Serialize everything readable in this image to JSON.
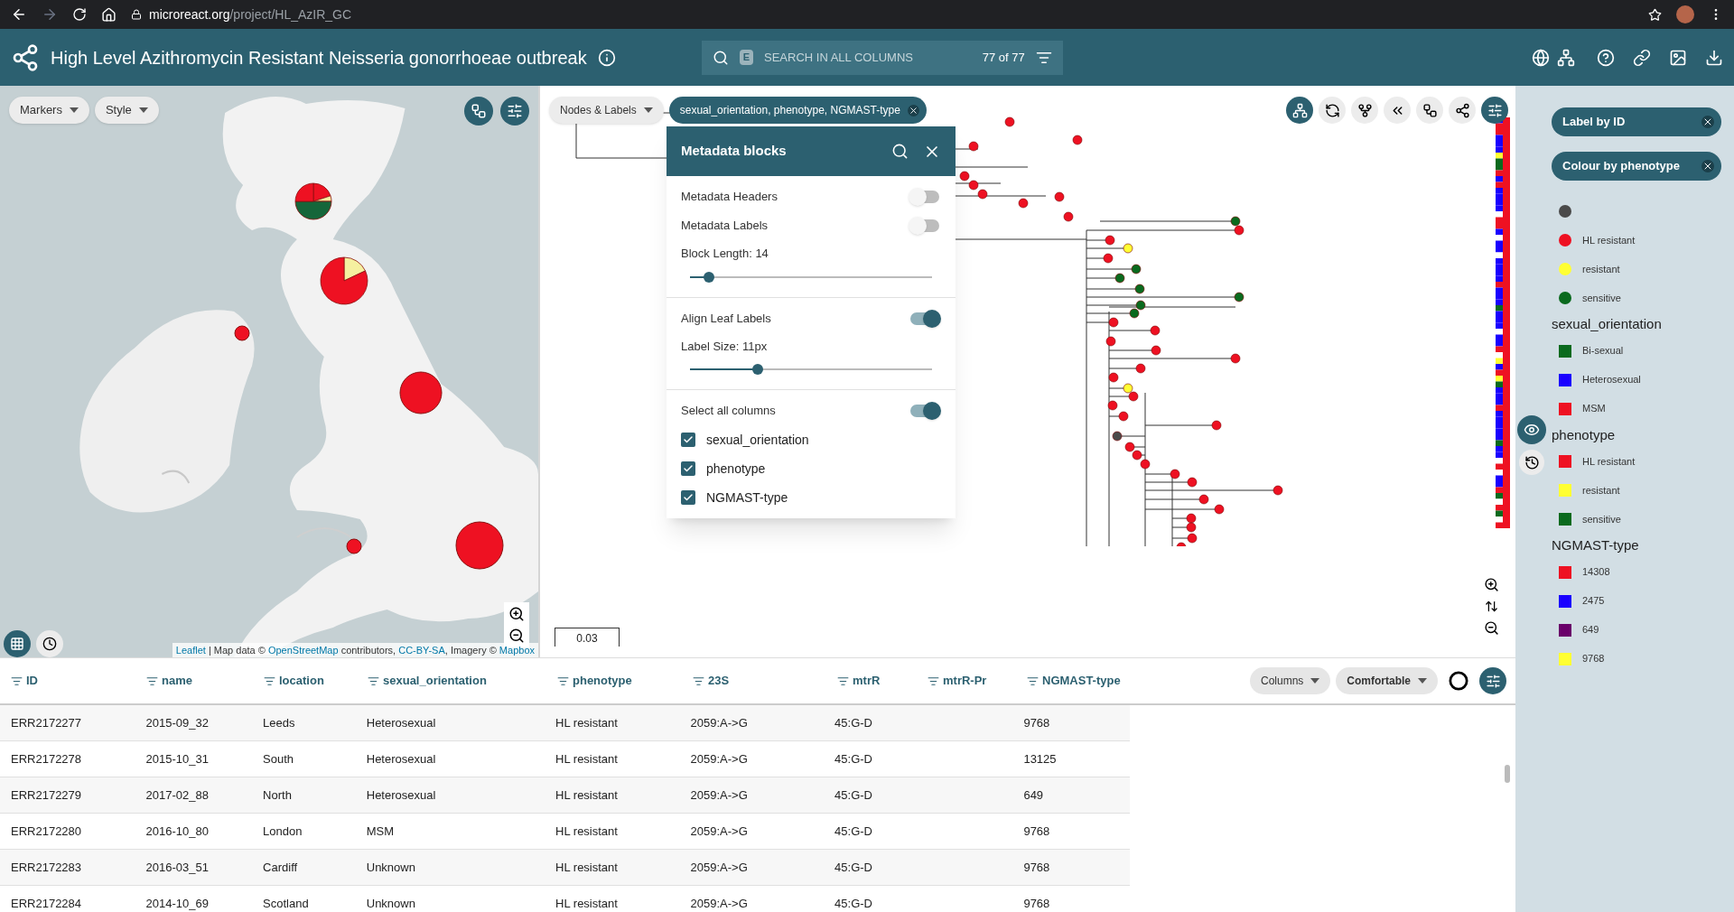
{
  "browser": {
    "host": "microreact.org",
    "path": "/project/HL_AzIR_GC"
  },
  "header": {
    "title": "High Level Azithromycin Resistant Neisseria gonorrhoeae outbreak",
    "search_key": "E",
    "search_placeholder": "SEARCH IN ALL COLUMNS",
    "count": "77 of 77"
  },
  "map": {
    "buttons": [
      "Markers",
      "Style"
    ],
    "attribution": [
      {
        "text": "Leaflet",
        "kind": "link"
      },
      {
        "text": " | Map data © ",
        "kind": "text"
      },
      {
        "text": "OpenStreetMap",
        "kind": "link"
      },
      {
        "text": " contributors, ",
        "kind": "text"
      },
      {
        "text": "CC-BY-SA",
        "kind": "link"
      },
      {
        "text": ", Imagery © ",
        "kind": "text"
      },
      {
        "text": "Mapbox",
        "kind": "link"
      }
    ]
  },
  "tree": {
    "menu": "Nodes & Labels",
    "chip": "sexual_orientation, phenotype, NGMAST-type",
    "scale": "0.03"
  },
  "metadata_panel": {
    "title": "Metadata blocks",
    "sections": [
      {
        "items": [
          {
            "kind": "toggle",
            "label": "Metadata Headers",
            "on": false
          },
          {
            "kind": "toggle",
            "label": "Metadata Labels",
            "on": false
          },
          {
            "kind": "slider",
            "label": "Block Length: 14",
            "level": 0.08
          }
        ]
      },
      {
        "items": [
          {
            "kind": "toggle",
            "label": "Align Leaf Labels",
            "on": true
          },
          {
            "kind": "slider",
            "label": "Label Size: 11px",
            "level": 0.28
          }
        ]
      },
      {
        "items": [
          {
            "kind": "toggle",
            "label": "Select all columns",
            "on": true
          },
          {
            "kind": "checkbox",
            "label": "sexual_orientation",
            "checked": true
          },
          {
            "kind": "checkbox",
            "label": "phenotype",
            "checked": true
          },
          {
            "kind": "checkbox",
            "label": "NGMAST-type",
            "checked": true
          }
        ]
      }
    ]
  },
  "legend": {
    "chips": [
      "Label by ID",
      "Colour by phenotype"
    ],
    "groups": [
      {
        "kind": "circle",
        "items": [
          {
            "color": "#4a4a4a"
          },
          {
            "label": "HL resistant",
            "color": "#ee1122"
          },
          {
            "label": "resistant",
            "color": "#ffff33"
          },
          {
            "label": "sensitive",
            "color": "#0a6a1e"
          }
        ]
      },
      {
        "title": "sexual_orientation",
        "kind": "square",
        "items": [
          {
            "label": "Bi-sexual",
            "color": "#0a6a1e"
          },
          {
            "label": "Heterosexual",
            "color": "#1a00ff"
          },
          {
            "label": "MSM",
            "color": "#ee1122"
          }
        ]
      },
      {
        "title": "phenotype",
        "kind": "square",
        "items": [
          {
            "label": "HL resistant",
            "color": "#ee1122"
          },
          {
            "label": "resistant",
            "color": "#ffff33"
          },
          {
            "label": "sensitive",
            "color": "#0a6a1e"
          }
        ]
      },
      {
        "title": "NGMAST-type",
        "kind": "square",
        "items": [
          {
            "label": "14308",
            "color": "#ee1122"
          },
          {
            "label": "2475",
            "color": "#1a00ff"
          },
          {
            "label": "649",
            "color": "#6a006a"
          },
          {
            "label": "9768",
            "color": "#ffff33"
          }
        ]
      }
    ]
  },
  "table": {
    "tools": [
      "Columns",
      "Comfortable"
    ],
    "columns": [
      "ID",
      "name",
      "location",
      "sexual_orientation",
      "phenotype",
      "23S",
      "mtrR",
      "mtrR-Pr",
      "NGMAST-type"
    ],
    "rows": [
      [
        "ERR2172277",
        "2015-09_32",
        "Leeds",
        "Heterosexual",
        "HL resistant",
        "2059:A->G",
        "45:G-D",
        "",
        "9768"
      ],
      [
        "ERR2172278",
        "2015-10_31",
        "South",
        "Heterosexual",
        "HL resistant",
        "2059:A->G",
        "45:G-D",
        "",
        "13125"
      ],
      [
        "ERR2172279",
        "2017-02_88",
        "North",
        "Heterosexual",
        "HL resistant",
        "2059:A->G",
        "45:G-D",
        "",
        "649"
      ],
      [
        "ERR2172280",
        "2016-10_80",
        "London",
        "MSM",
        "HL resistant",
        "2059:A->G",
        "45:G-D",
        "",
        "9768"
      ],
      [
        "ERR2172283",
        "2016-03_51",
        "Cardiff",
        "Unknown",
        "HL resistant",
        "2059:A->G",
        "45:G-D",
        "",
        "9768"
      ],
      [
        "ERR2172284",
        "2014-10_69",
        "Scotland",
        "Unknown",
        "HL resistant",
        "2059:A->G",
        "45:G-D",
        "",
        "9768"
      ]
    ]
  }
}
